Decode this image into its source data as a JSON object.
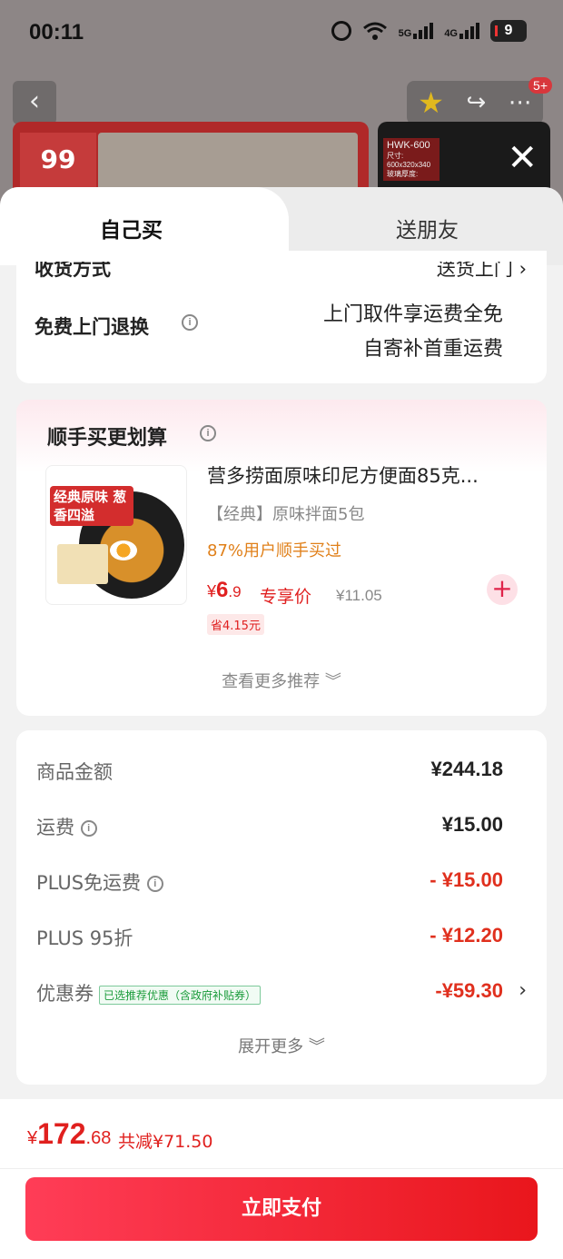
{
  "status_bar": {
    "time": "00:11",
    "signal1": "5G",
    "signal2": "4G",
    "battery": "9"
  },
  "background": {
    "badge": "5+",
    "image1_logo": "99",
    "image2_tag": "HWK-600",
    "image2_lines": [
      "尺寸:",
      "600x320x340",
      "玻璃厚度:"
    ]
  },
  "tabs": {
    "self": "自己买",
    "gift": "送朋友"
  },
  "delivery_card": {
    "partial_label": "收货方式",
    "partial_value": "送货上门 ›",
    "free_return_label": "免费上门退换",
    "free_return_line1": "上门取件享运费全免",
    "free_return_line2": "自寄补首重运费"
  },
  "addon_card": {
    "title": "顺手买更划算",
    "product": {
      "image_tag": "经典原味 葱香四溢",
      "name": "营多捞面原味印尼方便面85克...",
      "spec": "【经典】原味拌面5包",
      "buyers": "87%用户顺手买过",
      "price_currency": "¥",
      "price_int": "6",
      "price_dec": ".9",
      "exclusive_label": "专享价",
      "original_price": "¥11.05",
      "save": "省4.15元"
    },
    "more": "查看更多推荐 ︾"
  },
  "summary": {
    "rows": [
      {
        "label": "商品金额",
        "value": "¥244.18"
      },
      {
        "label": "运费",
        "value": "¥15.00"
      },
      {
        "label": "PLUS免运费",
        "value": "- ¥15.00"
      },
      {
        "label": "PLUS 95折",
        "value": "- ¥12.20"
      },
      {
        "label": "优惠券",
        "value": "-¥59.30",
        "badge": "已选推荐优惠（含政府补贴券）"
      }
    ],
    "expand": "展开更多 ︾"
  },
  "footer": {
    "currency": "¥",
    "total_int": "172",
    "total_dec": ".68",
    "total_save": "共减¥71.50",
    "pay_button": "立即支付"
  },
  "colors": {
    "accent": "#e0201e",
    "pay_gradient_start": "#ff3d57",
    "pay_gradient_end": "#e9161c",
    "buyers_orange": "#e0801a",
    "coupon_green": "#1a9b3a"
  }
}
